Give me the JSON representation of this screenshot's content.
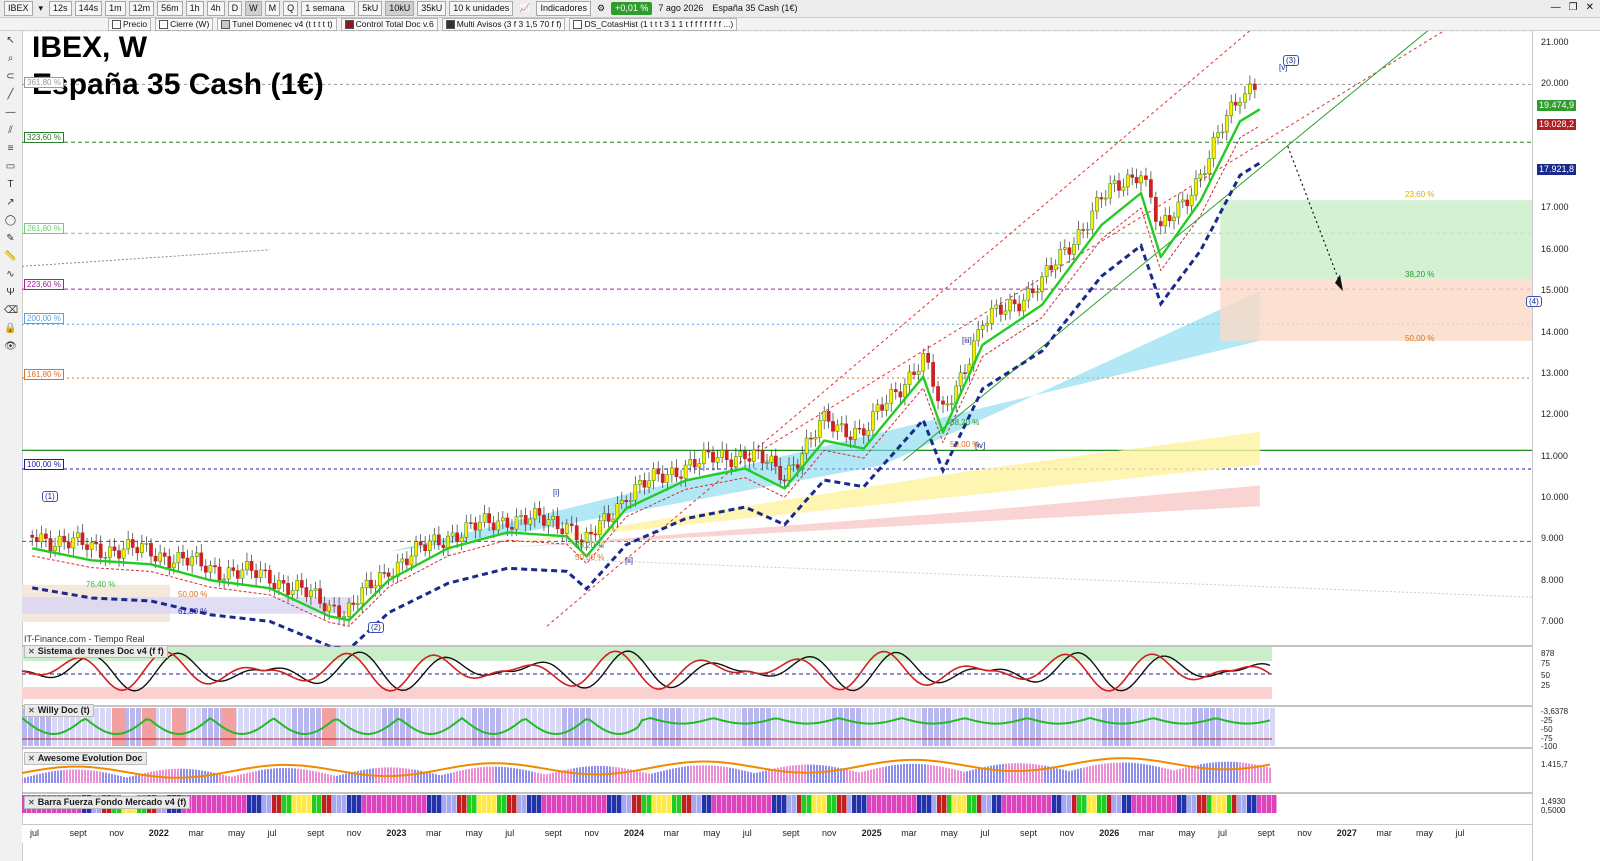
{
  "toolbar": {
    "symbol": "IBEX",
    "timeframes": [
      "12s",
      "144s",
      "1m",
      "12m",
      "56m",
      "1h",
      "4h",
      "D",
      "W",
      "M",
      "Q"
    ],
    "selected_timeframe": "W",
    "period": "1 semana",
    "units": [
      "5kU",
      "10kU",
      "35kU"
    ],
    "selected_unit": "10kU",
    "unit_count": "10 k unidades",
    "indicators_label": "Indicadores",
    "change": "+0,01 %",
    "date": "7 ago 2026",
    "instrument": "España 35 Cash (1€)"
  },
  "indicator_chips": [
    {
      "label": "Precio",
      "color": "#ffffff"
    },
    {
      "label": "Cierre (W)",
      "color": "#ffffff"
    },
    {
      "label": "Tunel Domenec v4 (t t t t t)",
      "color": "#c8c8c8"
    },
    {
      "label": "Control Total Doc v.6",
      "color": "#8b1a1a"
    },
    {
      "label": "Multi Avisos (3 f 3 1,5 70 f f)",
      "color": "#333333"
    },
    {
      "label": "DS_CotasHist (1 t t t 3 1 1 t f f f f f f f ...)",
      "color": "#ffffff"
    }
  ],
  "chart_title": {
    "line1": "IBEX, W",
    "line2": "España 35 Cash (1€)"
  },
  "source_label": "IT-Finance.com - Tiempo Real",
  "price_axis": {
    "ticks": [
      "21.000",
      "20.000",
      "17.000",
      "16.000",
      "15.000",
      "14.000",
      "13.000",
      "12.000",
      "11.000",
      "10.000",
      "9.000",
      "8.000",
      "7.000"
    ],
    "boxes": [
      {
        "label": "19.474,9",
        "color": "#2e9d2e"
      },
      {
        "label": "19.028,2",
        "color": "#b02020"
      },
      {
        "label": "17.921,8",
        "color": "#1a2a8a"
      }
    ]
  },
  "fib_levels": [
    {
      "label": "361,80 %",
      "color": "#999999"
    },
    {
      "label": "323,60 %",
      "color": "#2a7a2a"
    },
    {
      "label": "261,80 %",
      "color": "#6ad06a"
    },
    {
      "label": "223,60 %",
      "color": "#a020a0"
    },
    {
      "label": "200,00 %",
      "color": "#5aa0e0"
    },
    {
      "label": "161,80 %",
      "color": "#e07020"
    },
    {
      "label": "100,00 %",
      "color": "#1a1aaa"
    }
  ],
  "retrace_labels": [
    "23,60 %",
    "38,20 %",
    "50,00 %",
    "38,20 %",
    "50,00 %",
    "38,20 %",
    "50,00 %",
    "76,40 %",
    "50,00 %",
    "61,80 %"
  ],
  "wave_labels": [
    "(1)",
    "(2)",
    "[i]",
    "[ii]",
    "[iii]",
    "[iv]",
    "[v]",
    "(3)",
    "(4)"
  ],
  "panels": [
    {
      "name": "Sistema de trenes Doc v4 (f f)",
      "values": [
        "878",
        "75",
        "50",
        "25"
      ]
    },
    {
      "name": "Willy Doc (t)",
      "values": [
        "-3,6378",
        "-25",
        "-50",
        "-75",
        "-100"
      ]
    },
    {
      "name": "Awesome Evolution Doc",
      "values": [
        "1.415,7"
      ]
    },
    {
      "name": "Barra Fuerza Fondo Mercado v4 (f)",
      "values": [
        "1,4930",
        "0,5000"
      ]
    }
  ],
  "time_axis": [
    "jul",
    "sept",
    "nov",
    "2022",
    "mar",
    "may",
    "jul",
    "sept",
    "nov",
    "2023",
    "mar",
    "may",
    "jul",
    "sept",
    "nov",
    "2024",
    "mar",
    "may",
    "jul",
    "sept",
    "nov",
    "2025",
    "mar",
    "may",
    "jul",
    "sept",
    "nov",
    "2026",
    "mar",
    "may",
    "jul",
    "sept",
    "nov",
    "2027",
    "mar",
    "may",
    "jul"
  ],
  "chart_data": {
    "type": "candlestick",
    "symbol": "IBEX",
    "interval": "W",
    "ylim": [
      6800,
      21500
    ],
    "approx_close_path": [
      [
        "2021-06",
        9100
      ],
      [
        "2021-09",
        8800
      ],
      [
        "2021-12",
        8700
      ],
      [
        "2022-03",
        8300
      ],
      [
        "2022-06",
        8100
      ],
      [
        "2022-09",
        7400
      ],
      [
        "2022-10",
        7300
      ],
      [
        "2022-12",
        8300
      ],
      [
        "2023-03",
        9100
      ],
      [
        "2023-06",
        9500
      ],
      [
        "2023-09",
        9400
      ],
      [
        "2023-10",
        8900
      ],
      [
        "2023-12",
        10100
      ],
      [
        "2024-03",
        10800
      ],
      [
        "2024-06",
        11100
      ],
      [
        "2024-08",
        10600
      ],
      [
        "2024-10",
        11800
      ],
      [
        "2024-12",
        11600
      ],
      [
        "2025-03",
        13400
      ],
      [
        "2025-04",
        12000
      ],
      [
        "2025-06",
        14200
      ],
      [
        "2025-09",
        15200
      ],
      [
        "2025-12",
        17200
      ],
      [
        "2026-02",
        18000
      ],
      [
        "2026-03",
        16400
      ],
      [
        "2026-05",
        17800
      ],
      [
        "2026-07",
        19800
      ],
      [
        "2026-08",
        20100
      ]
    ],
    "projection": {
      "from": "2026-08",
      "to": "2026-12",
      "target_zone": [
        13800,
        17200
      ]
    }
  }
}
